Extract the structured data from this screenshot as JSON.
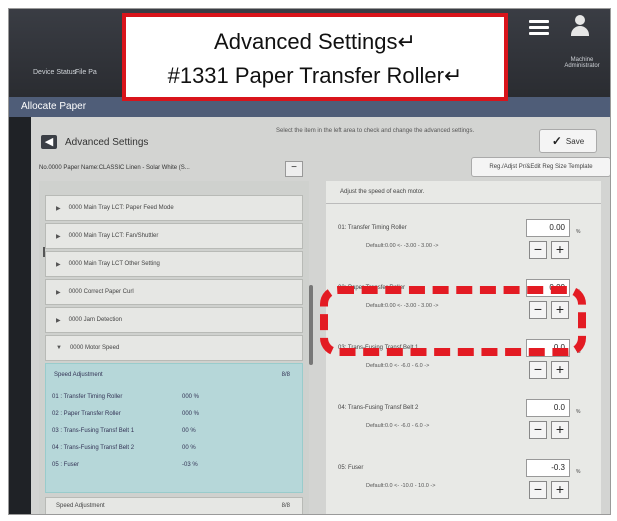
{
  "callout": {
    "line1": "Advanced Settings↵",
    "line2": "#1331 Paper Transfer Roller↵"
  },
  "device": {
    "tabs": [
      "Device Status",
      "File Pa"
    ],
    "user_label": "Machine Administrator",
    "page_title": "Allocate Paper"
  },
  "screen": {
    "title": "Advanced Settings",
    "instruction": "Select the item in the left area to check and change the advanced settings.",
    "save_label": "Save",
    "paper_name": "No.0000  Paper Name:CLASSIC Linen - Solar White (S...",
    "register_button": "Reg./Adjst Pr/&Edit Reg Size Template"
  },
  "left_list": {
    "items": [
      "0000 Main Tray LCT: Paper Feed Mode",
      "0000 Main Tray LCT: Fan/Shuttler",
      "0000 Main Tray LCT Other Setting",
      "0000 Correct Paper Curl",
      "0000 Jam Detection",
      "0000 Motor Speed"
    ],
    "expanded": {
      "header": "Speed Adjustment",
      "count": "8/8",
      "rows": [
        {
          "name": "01 : Transfer Timing Roller",
          "value": "000 %"
        },
        {
          "name": "02 : Paper Transfer Roller",
          "value": "000 %"
        },
        {
          "name": "03 : Trans-Fusing Transf Belt 1",
          "value": "00 %"
        },
        {
          "name": "04 : Trans-Fusing Transf Belt 2",
          "value": "00 %"
        },
        {
          "name": "05 : Fuser",
          "value": "-03 %"
        }
      ]
    },
    "bottom_item": {
      "label": "Speed Adjustment",
      "count": "8/8"
    }
  },
  "right_panel": {
    "heading": "Adjust the speed of each motor.",
    "settings": [
      {
        "name": "01: Transfer Timing Roller",
        "default": "Default:0.00  <- -3.00 - 3.00 ->",
        "value": "0.00",
        "unit": "%"
      },
      {
        "name": "02: Paper Transfer Roller",
        "default": "Default:0.00  <- -3.00 - 3.00 ->",
        "value": "0.00",
        "unit": "%"
      },
      {
        "name": "03: Trans-Fusing Transf Belt 1",
        "default": "Default:0.0  <- -6.0 - 6.0 ->",
        "value": "0.0",
        "unit": "%"
      },
      {
        "name": "04: Trans-Fusing Transf Belt 2",
        "default": "Default:0.0  <- -6.0 - 6.0 ->",
        "value": "0.0",
        "unit": "%"
      },
      {
        "name": "05: Fuser",
        "default": "Default:0.0  <- -10.0 - 10.0 ->",
        "value": "-0.3",
        "unit": "%"
      }
    ]
  },
  "colors": {
    "highlight": "#e31b23",
    "callout_border": "#d9141b",
    "expanded_bg": "#b6d7d9",
    "page_bar": "#4f5d78"
  },
  "icons": [
    "back-arrow-icon",
    "check-icon",
    "menu-icon",
    "user-icon",
    "chevron-right-icon",
    "chevron-down-icon",
    "minus-icon",
    "plus-icon"
  ]
}
